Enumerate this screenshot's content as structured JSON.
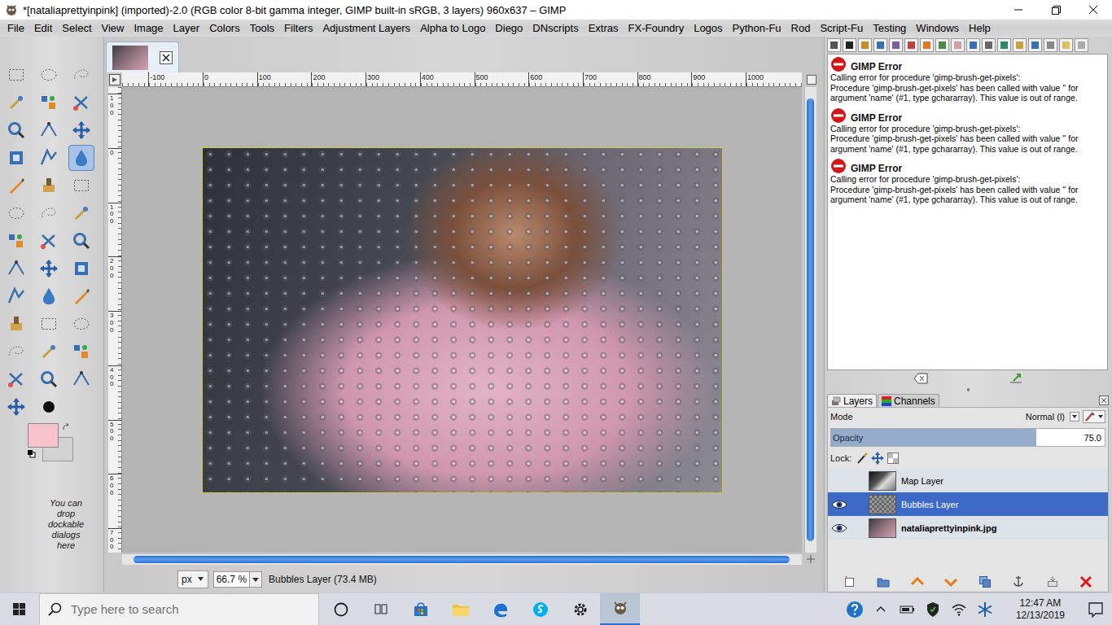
{
  "window": {
    "title": "*[nataliaprettyinpink] (imported)-2.0 (RGB color 8-bit gamma integer, GIMP built-in sRGB, 3 layers) 960x637 – GIMP"
  },
  "menu": [
    "File",
    "Edit",
    "Select",
    "View",
    "Image",
    "Layer",
    "Colors",
    "Tools",
    "Filters",
    "Adjustment Layers",
    "Alpha to Logo",
    "Diego",
    "DNscripts",
    "Extras",
    "FX-Foundry",
    "Logos",
    "Python-Fu",
    "Rod",
    "Script-Fu",
    "Testing",
    "Windows",
    "Help"
  ],
  "toolbox": {
    "tools": [
      {
        "selected": false
      },
      {
        "selected": false
      },
      {
        "selected": false
      },
      {
        "selected": false
      },
      {
        "selected": false
      },
      {
        "selected": false
      },
      {
        "selected": false
      },
      {
        "selected": false
      },
      {
        "selected": false
      },
      {
        "selected": false
      },
      {
        "selected": false
      },
      {
        "selected": true
      },
      {
        "selected": false
      },
      {
        "selected": false
      },
      {
        "selected": false
      },
      {
        "selected": false
      },
      {
        "selected": false
      },
      {
        "selected": false
      },
      {
        "selected": false
      },
      {
        "selected": false
      },
      {
        "selected": false
      },
      {
        "selected": false
      },
      {
        "selected": false
      },
      {
        "selected": false
      },
      {
        "selected": false
      },
      {
        "selected": false
      },
      {
        "selected": false
      },
      {
        "selected": false
      },
      {
        "selected": false
      },
      {
        "selected": false
      },
      {
        "selected": false
      },
      {
        "selected": false
      },
      {
        "selected": false
      },
      {
        "selected": false
      },
      {
        "selected": false
      },
      {
        "selected": false
      },
      {
        "selected": false
      },
      {
        "selected": false
      }
    ],
    "foreground": {
      "color": "#f9c3cd"
    },
    "background": {
      "color": "#d2d2d2"
    },
    "hint": "You can drop dockable dialogs here"
  },
  "canvas": {
    "ruler_h": [
      "-100",
      "0",
      "100",
      "200",
      "300",
      "400",
      "500",
      "600",
      "700",
      "800",
      "900",
      "1000"
    ],
    "ruler_v": [
      "100",
      "0",
      "100",
      "200",
      "300",
      "400",
      "500",
      "600",
      "700"
    ]
  },
  "status_bar": {
    "unit": "px",
    "zoom": "66.7 %",
    "info": "Bubbles Layer (73.4 MB)"
  },
  "error_console": {
    "entries": [
      {
        "title": "GIMP Error",
        "message": "Calling error for procedure 'gimp-brush-get-pixels':",
        "detail": "Procedure 'gimp-brush-get-pixels' has been called with value '' for argument 'name' (#1, type gchararray). This value is out of range."
      },
      {
        "title": "GIMP Error",
        "message": "Calling error for procedure 'gimp-brush-get-pixels':",
        "detail": "Procedure 'gimp-brush-get-pixels' has been called with value '' for argument 'name' (#1, type gchararray). This value is out of range."
      },
      {
        "title": "GIMP Error",
        "message": "Calling error for procedure 'gimp-brush-get-pixels':",
        "detail": "Procedure 'gimp-brush-get-pixels' has been called with value '' for argument 'name' (#1, type gchararray). This value is out of range."
      }
    ]
  },
  "layers_panel": {
    "tabs": [
      {
        "label": "Layers",
        "selected": true
      },
      {
        "label": "Channels",
        "selected": false
      }
    ],
    "mode_label": "Mode",
    "mode": "Normal (l)",
    "opacity_label": "Opacity",
    "opacity": "75.0",
    "opacity_level": 0.75,
    "lock_label": "Lock:",
    "layers": [
      {
        "name": "Map Layer",
        "visible": false,
        "selected": false,
        "bold": false,
        "kind": "map"
      },
      {
        "name": "Bubbles Layer",
        "visible": true,
        "selected": true,
        "bold": false,
        "kind": "transparent"
      },
      {
        "name": "nataliaprettyinpink.jpg",
        "visible": true,
        "selected": false,
        "bold": true,
        "kind": "photo"
      }
    ]
  },
  "taskbar": {
    "search_placeholder": "Type here to search",
    "apps": [
      {
        "active": false
      },
      {
        "active": false
      },
      {
        "active": false
      },
      {
        "active": false
      },
      {
        "active": false
      },
      {
        "active": false
      },
      {
        "active": false
      },
      {
        "active": true
      }
    ],
    "time": "12:47 AM",
    "date": "12/13/2019"
  }
}
